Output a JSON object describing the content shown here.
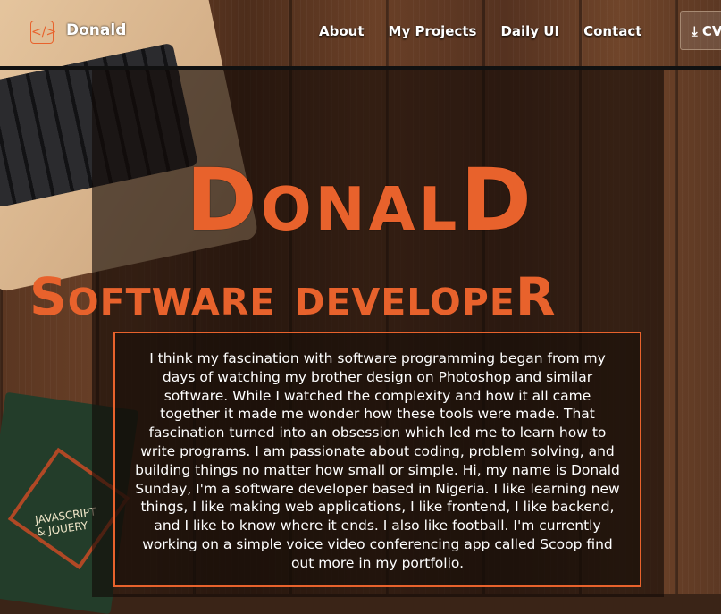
{
  "header": {
    "logo_icon": "code-bracket-icon",
    "logo_text": "Donald",
    "nav": [
      "About",
      "My Projects",
      "Daily UI",
      "Contact"
    ],
    "cv_label": "CV",
    "cv_icon": "download-icon"
  },
  "hero": {
    "name": "DonalD",
    "role": "Software developeR"
  },
  "about": {
    "text": "I think my fascination with software programming began from my days of watching my brother design on Photoshop and similar software. While I watched the complexity and how it all came together it made me wonder how these tools were made. That fascination turned into an obsession which led me to learn how to write programs. I am passionate about coding, problem solving, and building things no matter how small or simple. Hi, my name is Donald Sunday, I'm a software developer based in Nigeria. I like learning new things, I like making web applications, I like frontend, I like backend, and I like to know where it ends. I also like football. I'm currently working on a simple voice video conferencing app called Scoop find out more in my portfolio."
  },
  "background_book": {
    "line1": "JAVASCRIPT",
    "line2": "& JQUERY"
  },
  "colors": {
    "accent": "#e8622c",
    "text": "#ffffff"
  }
}
